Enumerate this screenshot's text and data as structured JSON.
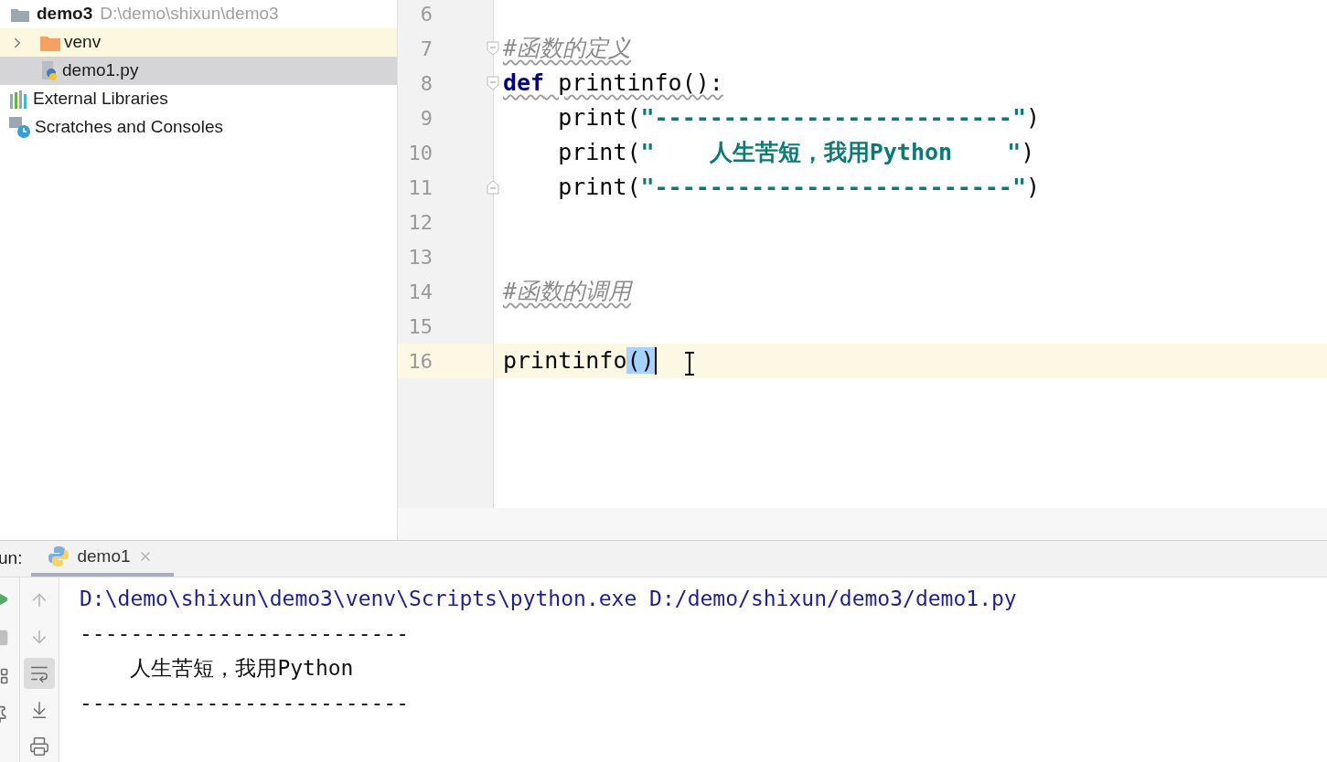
{
  "project_tree": {
    "root": {
      "name": "demo3",
      "path": "D:\\demo\\shixun\\demo3",
      "children": [
        {
          "name": "venv",
          "kind": "folder",
          "expanded": false,
          "selected": false,
          "highlighted": true
        },
        {
          "name": "demo1.py",
          "kind": "python",
          "selected": true,
          "highlighted": false
        }
      ]
    },
    "items": [
      {
        "name": "External Libraries",
        "kind": "libraries",
        "selected": false
      },
      {
        "name": "Scratches and Consoles",
        "kind": "scratches",
        "selected": false
      }
    ]
  },
  "editor": {
    "lines": [
      {
        "number": "6",
        "current": false,
        "kind": "plain"
      },
      {
        "number": "7",
        "current": false,
        "kind": "fold-start",
        "squiggly": true,
        "tokens": [
          {
            "text": "#函数的定义",
            "kind": "comment"
          }
        ]
      },
      {
        "number": "8",
        "current": false,
        "kind": "fold-start",
        "squiggly": true,
        "tokens": [
          {
            "text": "def",
            "kind": "keyword"
          },
          {
            "text": " printinfo():",
            "kind": "plain"
          }
        ]
      },
      {
        "number": "9",
        "current": false,
        "kind": "plain",
        "squiggly": false,
        "tokens": [
          {
            "text": "    print(",
            "kind": "plain"
          },
          {
            "text": "\"--------------------------\"",
            "kind": "string"
          },
          {
            "text": ")",
            "kind": "plain"
          }
        ]
      },
      {
        "number": "10",
        "current": false,
        "kind": "plain",
        "squiggly": false,
        "tokens": [
          {
            "text": "    print(",
            "kind": "plain"
          },
          {
            "text": "\"    人生苦短，我用Python    \"",
            "kind": "string"
          },
          {
            "text": ")",
            "kind": "plain"
          }
        ]
      },
      {
        "number": "11",
        "current": false,
        "kind": "fold-end",
        "squiggly": false,
        "tokens": [
          {
            "text": "    print(",
            "kind": "plain"
          },
          {
            "text": "\"--------------------------\"",
            "kind": "string"
          },
          {
            "text": ")",
            "kind": "plain"
          }
        ]
      },
      {
        "number": "12",
        "current": false,
        "kind": "plain"
      },
      {
        "number": "13",
        "current": false,
        "kind": "plain"
      },
      {
        "number": "14",
        "current": false,
        "kind": "plain",
        "squiggly": true,
        "tokens": [
          {
            "text": "#函数的调用",
            "kind": "comment"
          }
        ]
      },
      {
        "number": "15",
        "current": false,
        "kind": "plain"
      },
      {
        "number": "16",
        "current": true,
        "kind": "plain",
        "squiggly": false,
        "tokens": [
          {
            "text": "printinfo",
            "kind": "plain"
          },
          {
            "text": "()",
            "kind": "selected"
          }
        ]
      }
    ]
  },
  "run_panel": {
    "label": "un:",
    "tabs": [
      {
        "label": "demo1",
        "selected": true
      }
    ],
    "toolbar": [
      {
        "kind": "up",
        "on": false
      },
      {
        "kind": "down",
        "on": false
      },
      {
        "kind": "wrap",
        "on": true
      },
      {
        "kind": "scroll-end",
        "on": false
      },
      {
        "kind": "print",
        "on": false
      }
    ],
    "console": [
      {
        "text": "D:\\demo\\shixun\\demo3\\venv\\Scripts\\python.exe D:/demo/shixun/demo3/demo1.py",
        "kind": "command"
      },
      {
        "text": "--------------------------",
        "kind": "output"
      },
      {
        "text": "    人生苦短，我用Python",
        "kind": "output"
      },
      {
        "text": "--------------------------",
        "kind": "output"
      }
    ]
  }
}
